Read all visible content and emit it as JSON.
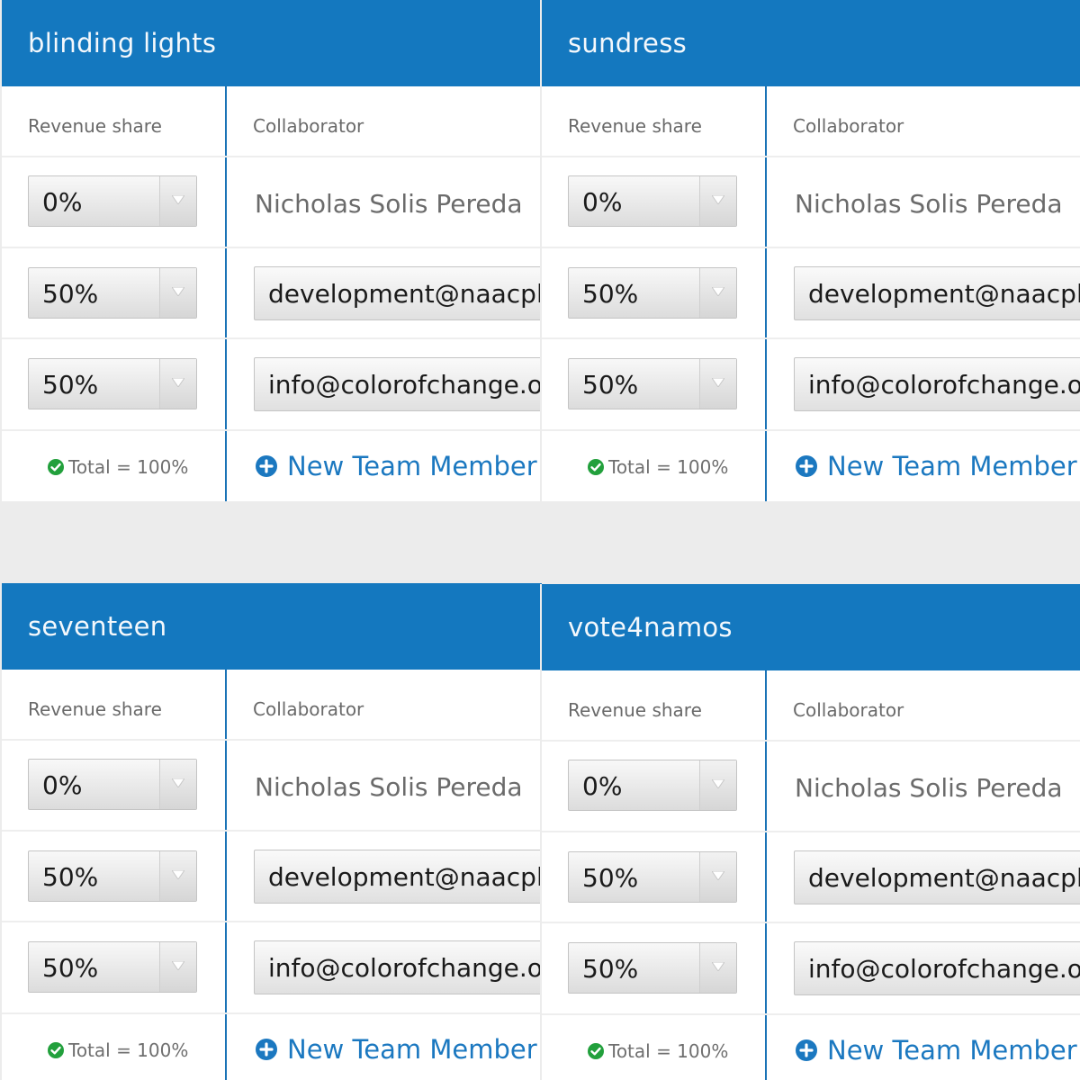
{
  "colors": {
    "header": "#1478bf",
    "accent": "#1b78c0",
    "check": "#22a03c"
  },
  "labels": {
    "revenue_share": "Revenue share",
    "collaborator": "Collaborator",
    "total": "Total = 100%",
    "new_member": "New Team Member"
  },
  "icons": {
    "dropdown": "triangle-down-icon",
    "check": "check-circle-icon",
    "add": "plus-circle-icon"
  },
  "cards": [
    {
      "title": "blinding lights",
      "rows": [
        {
          "share": "0%",
          "collaborator": "Nicholas Solis Pereda"
        },
        {
          "share": "50%",
          "collaborator": "development@naacpldf.org"
        },
        {
          "share": "50%",
          "collaborator": "info@colorofchange.org"
        }
      ]
    },
    {
      "title": "sundress",
      "rows": [
        {
          "share": "0%",
          "collaborator": "Nicholas Solis Pereda"
        },
        {
          "share": "50%",
          "collaborator": "development@naacpldf.org"
        },
        {
          "share": "50%",
          "collaborator": "info@colorofchange.org"
        }
      ]
    },
    {
      "title": "seventeen",
      "rows": [
        {
          "share": "0%",
          "collaborator": "Nicholas Solis Pereda"
        },
        {
          "share": "50%",
          "collaborator": "development@naacpldf.org"
        },
        {
          "share": "50%",
          "collaborator": "info@colorofchange.org"
        }
      ]
    },
    {
      "title": "vote4namos",
      "rows": [
        {
          "share": "0%",
          "collaborator": "Nicholas Solis Pereda"
        },
        {
          "share": "50%",
          "collaborator": "development@naacpldf.org"
        },
        {
          "share": "50%",
          "collaborator": "info@colorofchange.org"
        }
      ]
    }
  ]
}
